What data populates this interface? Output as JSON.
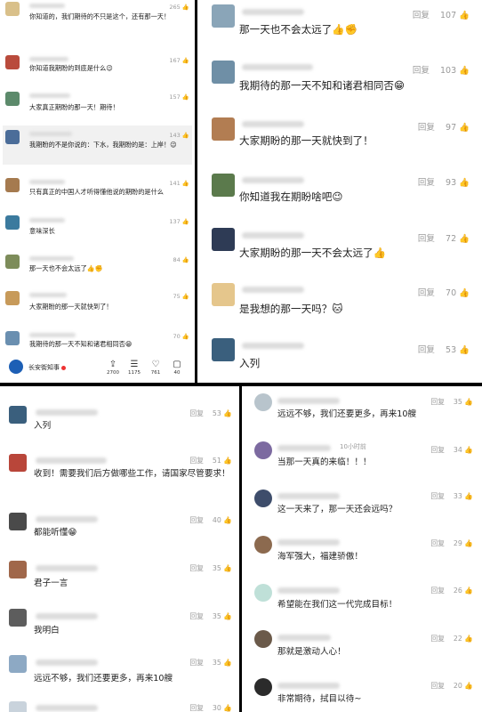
{
  "reply_label": "回复",
  "tl": {
    "comments": [
      {
        "text": "你知道的，我们期待的不只是这个，还有那一天！",
        "likes": "265"
      },
      {
        "text": "你知道我期盼的到底是什么😉",
        "likes": "167"
      },
      {
        "text": "大家真正期盼的那一天！期待！",
        "likes": "157"
      },
      {
        "text": "我期盼的不是你说的：下水，我期盼的是：上岸！😉",
        "likes": "143"
      },
      {
        "text": "只有真正的中国人才听得懂他说的期盼的是什么",
        "likes": "141"
      },
      {
        "text": "意味深长",
        "likes": "137"
      },
      {
        "text": "那一天也不会太远了👍✊",
        "likes": "84"
      },
      {
        "text": "大家期盼的那一天就快到了！",
        "likes": "75"
      },
      {
        "text": "我期待的那一天不知和诸君相同否😁",
        "likes": "70"
      }
    ],
    "footer": {
      "account": "长安街知事",
      "actions": [
        {
          "icon": "share-icon",
          "count": "2700"
        },
        {
          "icon": "comment-icon",
          "count": "1175"
        },
        {
          "icon": "heart-icon",
          "count": "761"
        },
        {
          "icon": "chat-icon",
          "count": "40"
        }
      ]
    }
  },
  "tr": {
    "comments": [
      {
        "text": "那一天也不会太远了👍✊",
        "likes": "107"
      },
      {
        "text": "我期待的那一天不知和诸君相同否😁",
        "likes": "103"
      },
      {
        "text": "大家期盼的那一天就快到了！",
        "likes": "97"
      },
      {
        "text": "你知道我在期盼啥吧😉",
        "likes": "93"
      },
      {
        "text": "大家期盼的那一天不会太远了👍",
        "likes": "72"
      },
      {
        "text": "是我想的那一天吗？🐱",
        "likes": "70"
      },
      {
        "text": "入列",
        "likes": "53"
      }
    ]
  },
  "bl": {
    "comments": [
      {
        "text": "入列",
        "likes": "53"
      },
      {
        "text": "收到！需要我们后方做哪些工作，请国家尽管要求！",
        "likes": "51"
      },
      {
        "text": "都能听懂😁",
        "likes": "40"
      },
      {
        "text": "君子一言",
        "likes": "35"
      },
      {
        "text": "我明白",
        "likes": "35"
      },
      {
        "text": "远远不够，我们还要更多，再来10艘",
        "likes": "35"
      }
    ],
    "last_likes": "30"
  },
  "br": {
    "comments": [
      {
        "text": "远远不够，我们还要更多，再来10艘",
        "likes": "35"
      },
      {
        "text": "当那一天真的来临！！！",
        "likes": "34",
        "time": "10小时前"
      },
      {
        "text": "这一天来了，那一天还会远吗？",
        "likes": "33"
      },
      {
        "text": "海军强大，福建骄傲！",
        "likes": "29"
      },
      {
        "text": "希望能在我们这一代完成目标！",
        "likes": "26"
      },
      {
        "text": "那就是激动人心！",
        "likes": "22"
      },
      {
        "text": "非常期待，拭目以待~",
        "likes": "20"
      }
    ]
  },
  "colors": {
    "background": "#000000",
    "panel": "#ffffff",
    "text": "#222222",
    "meta": "#9a9a9a"
  }
}
